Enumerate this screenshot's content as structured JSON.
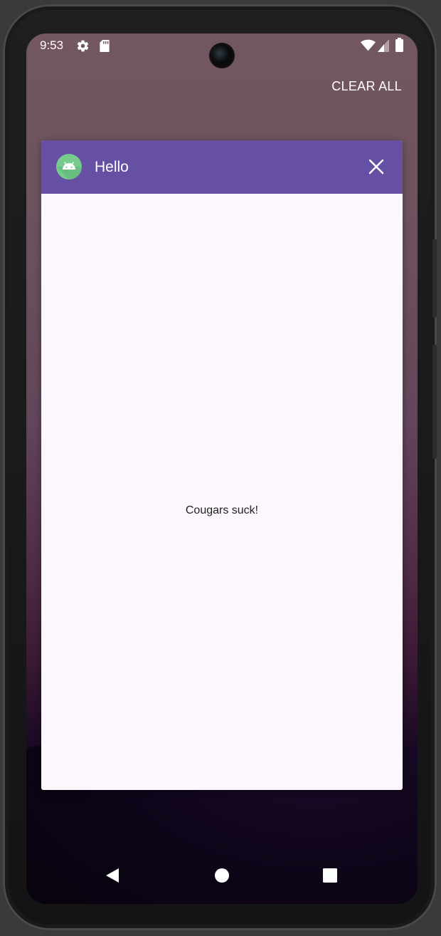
{
  "status_bar": {
    "time": "9:53",
    "icons": [
      "gear-icon",
      "sd-card-icon",
      "wifi-icon",
      "signal-icon",
      "battery-icon"
    ]
  },
  "recents": {
    "clear_all_label": "CLEAR ALL"
  },
  "task_card": {
    "app_title": "Hello",
    "app_icon": "android-icon",
    "header_color": "#6650a3",
    "message": "Cougars suck!"
  },
  "nav_bar": {
    "buttons": [
      "back-icon",
      "home-icon",
      "recents-icon"
    ]
  }
}
